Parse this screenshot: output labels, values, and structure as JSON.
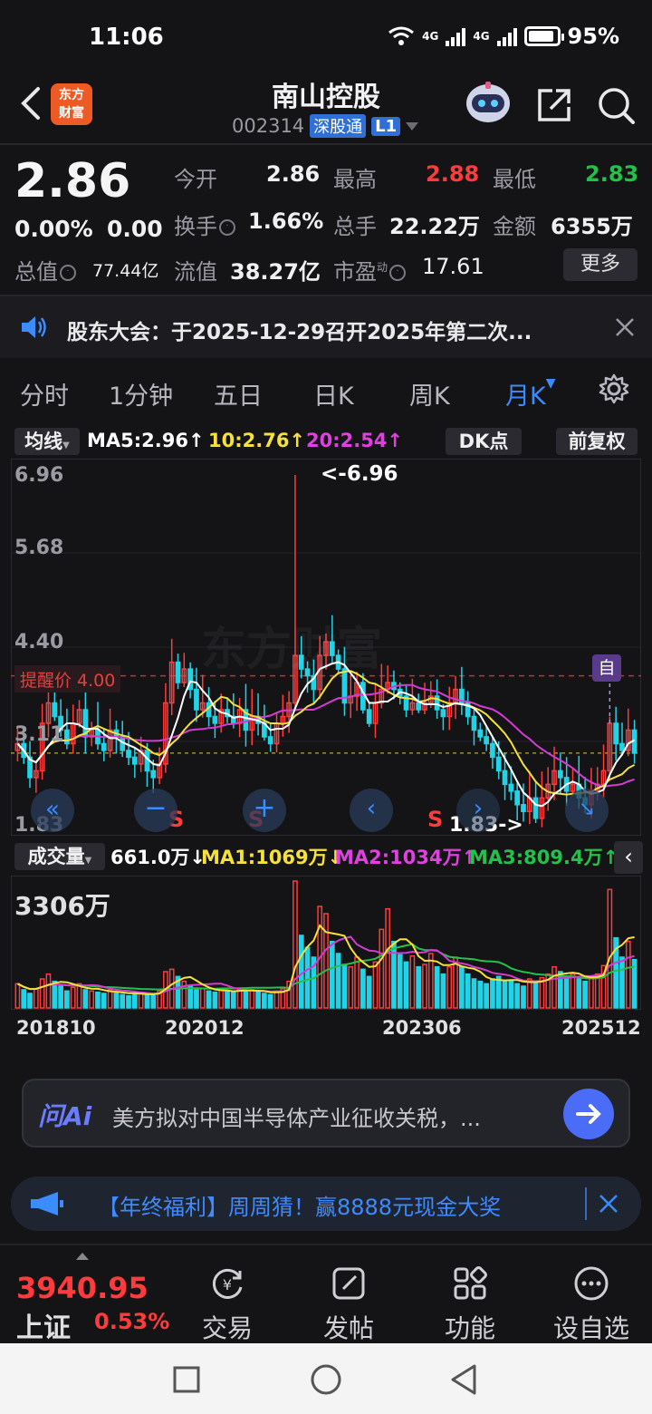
{
  "status": {
    "time": "11:06",
    "battery": "95%",
    "net1": "4G",
    "net2": "4G"
  },
  "header": {
    "title": "南山控股",
    "code": "002314",
    "tag": "深股通",
    "level": "L1",
    "logo_line1": "东方",
    "logo_line2": "财富"
  },
  "quote": {
    "price": "2.86",
    "change_pct": "0.00%",
    "change": "0.00",
    "fields": {
      "open_label": "今开",
      "open": "2.86",
      "high_label": "最高",
      "high": "2.88",
      "low_label": "最低",
      "low": "2.83",
      "turnover_label": "换手",
      "turnover": "1.66%",
      "volume_label": "总手",
      "volume": "22.22万",
      "amount_label": "金额",
      "amount": "6355万",
      "mktcap_label": "总值",
      "mktcap": "77.44亿",
      "float_label": "流值",
      "float": "38.27亿",
      "pe_label": "市盈",
      "pe_sup": "动",
      "pe": "17.61"
    },
    "more_label": "更多"
  },
  "notice": {
    "text": "股东大会：于2025-12-29召开2025年第二次..."
  },
  "tabs": [
    {
      "label": "分时"
    },
    {
      "label": "1分钟"
    },
    {
      "label": "五日"
    },
    {
      "label": "日K"
    },
    {
      "label": "周K"
    },
    {
      "label": "月K"
    }
  ],
  "ma_bar": {
    "selector": "均线",
    "ma5": "MA5:2.96↑",
    "ma10": "10:2.76↑",
    "ma20": "20:2.54↑",
    "dk": "DK点",
    "adjust": "前复权"
  },
  "kchart": {
    "y_labels": [
      "6.96",
      "5.68",
      "4.40",
      "3.11",
      "1.83"
    ],
    "alert_label": "提醒价 4.00",
    "max_label": "<-6.96",
    "min_label": "1.83->",
    "self_marker": "自",
    "watermark": "东方财富",
    "s_marks": [
      "S",
      "S",
      "S"
    ]
  },
  "vol_bar": {
    "selector": "成交量",
    "vol": "661.0万↓",
    "ma1": "MA1:1069万↓",
    "ma2": "MA2:1034万↑",
    "ma3": "MA3:809.4万↑"
  },
  "volchart": {
    "max_label": "3306万"
  },
  "x_labels": [
    "201810",
    "202012",
    "202306",
    "202512"
  ],
  "ai": {
    "brand": "问Ai",
    "text": "美方拟对中国半导体产业征收关税，..."
  },
  "promo": {
    "text": "【年终福利】周周猜！赢8888元现金大奖"
  },
  "bottom": {
    "index_value": "3940.95",
    "index_name": "上证",
    "index_pct": "0.53%",
    "items": [
      {
        "label": "交易"
      },
      {
        "label": "发帖"
      },
      {
        "label": "功能"
      },
      {
        "label": "设自选"
      }
    ]
  },
  "colors": {
    "up": "#ff3b3b",
    "down": "#22d3e6",
    "ma5": "#ffffff",
    "ma10": "#f5e13a",
    "ma20": "#d33bd3",
    "accent": "#3a8cff"
  },
  "chart_data": {
    "type": "candlestick",
    "period": "monthly",
    "x": [
      "201810",
      "202012",
      "202306",
      "202512"
    ],
    "ylim": [
      1.83,
      6.96
    ],
    "last": {
      "open": 2.86,
      "high": 2.88,
      "low": 2.83,
      "close": 2.86
    },
    "ma": {
      "MA5": 2.96,
      "MA10": 2.76,
      "MA20": 2.54
    },
    "alert_price": 4.0,
    "period_high": 6.96,
    "period_low": 1.83,
    "volume_max": "3306万",
    "volume_ma": {
      "MA1": "1069万",
      "MA2": "1034万",
      "MA3": "809.4万"
    },
    "closes": [
      3.0,
      2.8,
      2.5,
      2.6,
      3.3,
      3.6,
      3.4,
      3.2,
      3.0,
      3.3,
      3.5,
      3.1,
      3.2,
      3.0,
      2.9,
      3.2,
      3.1,
      2.9,
      2.8,
      2.7,
      2.9,
      2.6,
      2.5,
      2.7,
      3.6,
      4.2,
      3.9,
      4.1,
      3.8,
      3.5,
      3.6,
      3.4,
      3.3,
      3.5,
      3.4,
      3.3,
      3.5,
      3.2,
      3.4,
      3.3,
      3.1,
      3.0,
      3.3,
      3.4,
      3.6,
      4.3,
      4.1,
      4.0,
      3.8,
      4.3,
      4.5,
      4.3,
      4.1,
      3.6,
      3.7,
      3.9,
      3.5,
      3.3,
      3.6,
      3.8,
      3.9,
      3.8,
      3.7,
      3.5,
      3.6,
      3.5,
      3.6,
      3.7,
      3.5,
      3.4,
      3.6,
      3.8,
      3.6,
      3.4,
      3.2,
      3.1,
      3.0,
      2.8,
      2.6,
      2.4,
      2.3,
      2.1,
      2.0,
      2.2,
      1.9,
      2.2,
      2.4,
      2.6,
      2.5,
      2.3,
      2.4,
      2.2,
      2.1,
      2.3,
      2.4,
      2.6,
      3.3,
      3.0,
      2.9,
      3.2,
      2.86
    ],
    "volumes": [
      2,
      1.5,
      1.2,
      1.6,
      2.4,
      2.8,
      2.2,
      1.8,
      1.4,
      1.7,
      2.0,
      1.5,
      1.4,
      1.3,
      1.2,
      1.5,
      1.3,
      1.1,
      1.0,
      1.2,
      1.3,
      1.1,
      1.0,
      1.4,
      3.0,
      3.2,
      2.6,
      2.2,
      1.8,
      1.5,
      1.6,
      1.4,
      1.3,
      1.5,
      1.4,
      1.3,
      1.6,
      1.4,
      1.5,
      1.3,
      1.2,
      1.1,
      1.4,
      1.6,
      2.2,
      10.5,
      6.0,
      5.0,
      4.2,
      8.4,
      7.8,
      5.5,
      4.5,
      3.6,
      3.4,
      4.2,
      3.2,
      2.6,
      3.8,
      6.5,
      8.2,
      5.5,
      4.4,
      3.8,
      4.3,
      3.4,
      3.6,
      4.5,
      3.4,
      2.8,
      3.4,
      4.2,
      3.4,
      2.8,
      2.4,
      2.2,
      2.0,
      2.4,
      2.6,
      2.2,
      2.3,
      2.0,
      1.8,
      2.4,
      2.2,
      2.5,
      2.8,
      3.4,
      3.0,
      2.6,
      2.8,
      2.4,
      2.2,
      2.6,
      2.8,
      3.5,
      9.8,
      5.8,
      4.2,
      5.5,
      4.0
    ]
  }
}
